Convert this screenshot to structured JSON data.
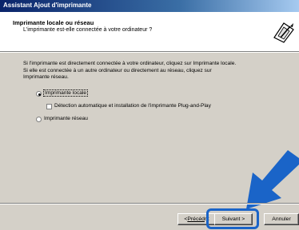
{
  "window": {
    "title": "Assistant Ajout d'imprimante"
  },
  "header": {
    "title": "Imprimante locale ou réseau",
    "subtitle": "L'imprimante est-elle connectée à votre ordinateur ?",
    "icon": "printer-wizard-icon"
  },
  "body": {
    "line1": "Si l'imprimante est directement connectée à votre ordinateur, cliquez sur Imprimante locale.",
    "line2": "Si elle est connectée à un autre ordinateur ou directement au réseau, cliquez sur",
    "line3": "Imprimante réseau."
  },
  "options": {
    "local_label": "Imprimante locale",
    "local_selected": true,
    "pnp_label": "Détection automatique et installation de l'imprimante Plug-and-Play",
    "pnp_checked": false,
    "network_label": "Imprimante réseau",
    "network_selected": false
  },
  "buttons": {
    "back_prefix": "< ",
    "back_label": "Précéd",
    "back_suffix": "nt",
    "next_label": "Suivant >",
    "cancel_label": "Annuler"
  },
  "colors": {
    "highlight": "#1a64c8",
    "arrow": "#1a64c8"
  }
}
